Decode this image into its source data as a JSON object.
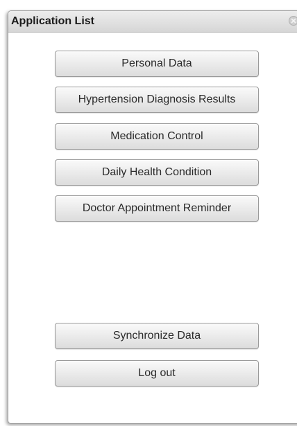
{
  "window": {
    "title": "Application List",
    "close_icon": "close-icon"
  },
  "menu": {
    "items": [
      {
        "label": "Personal Data"
      },
      {
        "label": "Hypertension Diagnosis Results"
      },
      {
        "label": "Medication Control"
      },
      {
        "label": "Daily Health Condition"
      },
      {
        "label": "Doctor Appointment Reminder"
      }
    ]
  },
  "actions": {
    "sync_label": "Synchronize Data",
    "logout_label": "Log out"
  },
  "colors": {
    "title_bar": "#dcdcdc",
    "button_face": "#eaeaea",
    "button_border": "#9a9a9a",
    "text": "#2a2a2a"
  }
}
